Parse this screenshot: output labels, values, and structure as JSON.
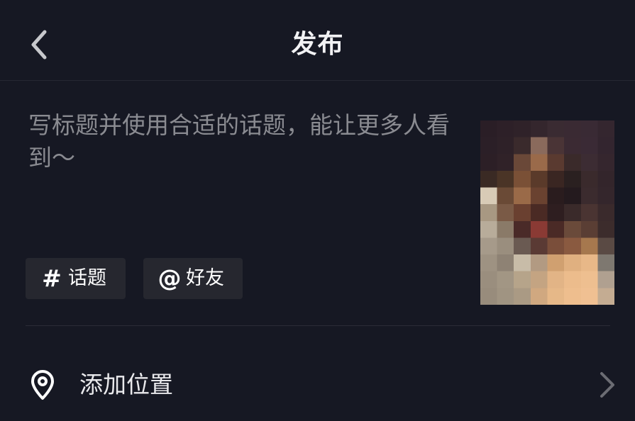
{
  "colors": {
    "background": "#161823",
    "chip_background": "#26272f",
    "placeholder": "#8a8b91",
    "divider": "#2b2c36",
    "chevron": "#6b6c73"
  },
  "header": {
    "back_icon": "chevron-left-icon",
    "title": "发布"
  },
  "composer": {
    "caption_placeholder": "写标题并使用合适的话题，能让更多人看到～",
    "caption_value": "",
    "chips": [
      {
        "icon": "hashtag-icon",
        "symbol": "#",
        "label": "话题"
      },
      {
        "icon": "at-icon",
        "symbol": "@",
        "label": "好友"
      }
    ],
    "cover": {
      "description": "pixelated-cover-thumbnail"
    }
  },
  "location": {
    "icon": "location-pin-icon",
    "label": "添加位置",
    "chevron": "chevron-right-icon"
  }
}
